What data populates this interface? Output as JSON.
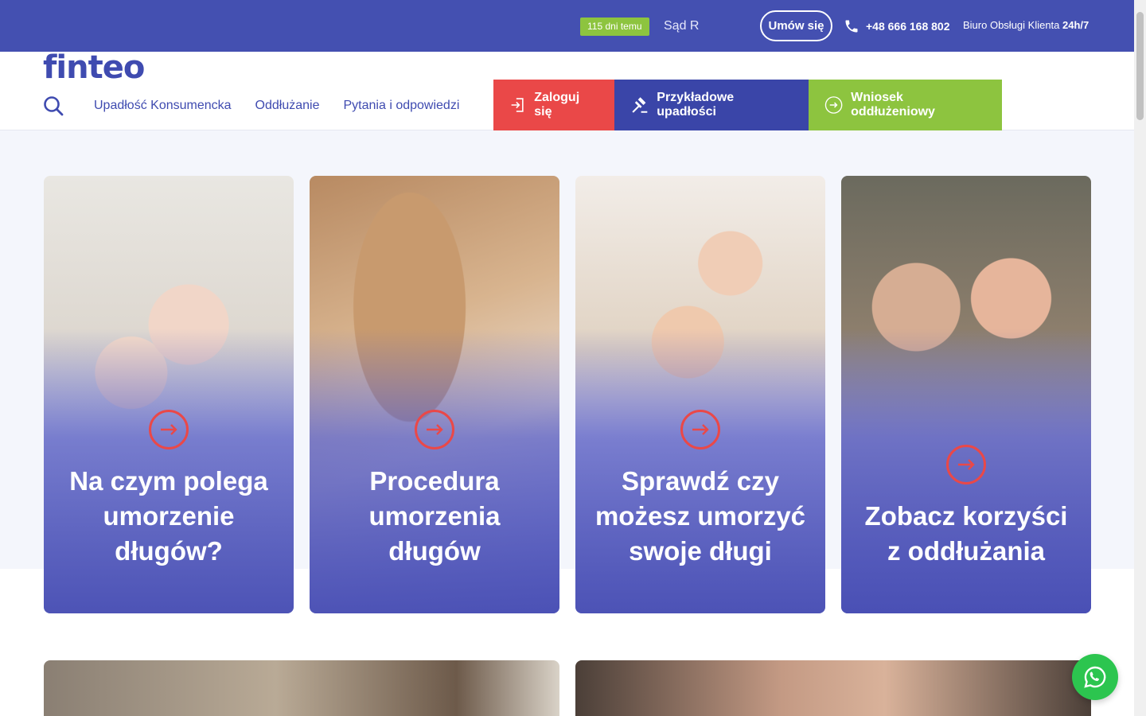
{
  "topbar": {
    "badge": "115 dni temu",
    "ticker": "Sąd R",
    "appointment_button": "Umów się",
    "phone": "+48 666 168 802",
    "office_label": "Biuro Obsługi Klienta",
    "office_hours": "24h/7"
  },
  "header": {
    "logo": "finteo",
    "nav": [
      "Upadłość Konsumencka",
      "Oddłużanie",
      "Pytania i odpowiedzi"
    ],
    "login": "Zaloguj się",
    "examples": "Przykładowe upadłości",
    "application": "Wniosek oddłużeniowy"
  },
  "cards": [
    {
      "title": "Na czym polega umorzenie długów?"
    },
    {
      "title": "Procedura umorzenia długów"
    },
    {
      "title": "Sprawdź czy możesz umorzyć swoje długi"
    },
    {
      "title": "Zobacz korzyści z oddłużania"
    }
  ],
  "colors": {
    "primary": "#4450b1",
    "accent_red": "#ea4848",
    "accent_green": "#8dc43f",
    "whatsapp": "#2cc54f"
  }
}
